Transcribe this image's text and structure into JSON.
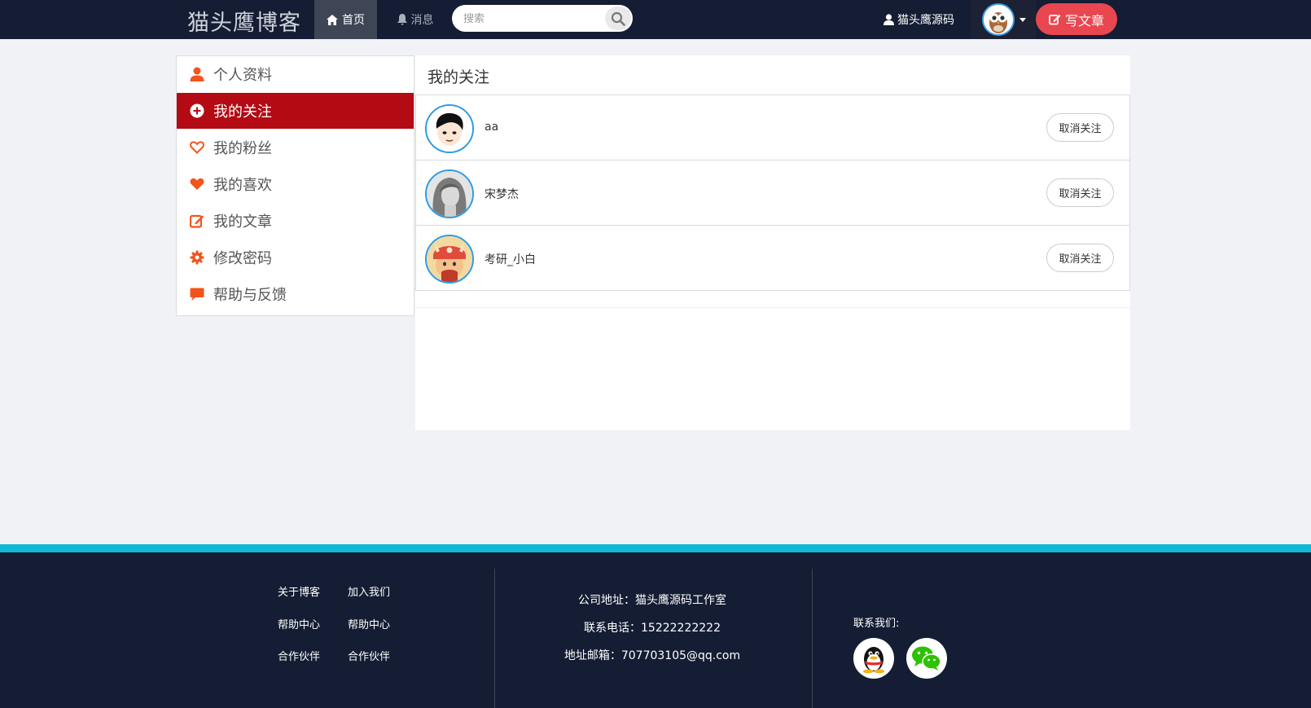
{
  "header": {
    "brand": "猫头鹰博客",
    "nav": [
      {
        "label": "首页",
        "icon": "home-icon",
        "active": true
      },
      {
        "label": "消息",
        "icon": "bell-icon",
        "active": false
      }
    ],
    "search_placeholder": "搜索",
    "username": "猫头鹰源码",
    "write_label": "写文章"
  },
  "sidebar": {
    "items": [
      {
        "label": "个人资料",
        "icon": "user-icon",
        "active": false
      },
      {
        "label": "我的关注",
        "icon": "plus-circle-icon",
        "active": true
      },
      {
        "label": "我的粉丝",
        "icon": "heart-outline-icon",
        "active": false
      },
      {
        "label": "我的喜欢",
        "icon": "heart-icon",
        "active": false
      },
      {
        "label": "我的文章",
        "icon": "edit-icon",
        "active": false
      },
      {
        "label": "修改密码",
        "icon": "gear-icon",
        "active": false
      },
      {
        "label": "帮助与反馈",
        "icon": "comment-icon",
        "active": false
      }
    ]
  },
  "main": {
    "title": "我的关注",
    "follows": [
      {
        "name": "aa",
        "action": "取消关注"
      },
      {
        "name": "宋梦杰",
        "action": "取消关注"
      },
      {
        "name": "考研_小白",
        "action": "取消关注"
      }
    ]
  },
  "footer": {
    "links_col1": [
      "关于博客",
      "帮助中心",
      "合作伙伴"
    ],
    "links_col2": [
      "加入我们",
      "帮助中心",
      "合作伙伴"
    ],
    "address": "公司地址：猫头鹰源码工作室",
    "phone": "联系电话：15222222222",
    "email": "地址邮箱：707703105@qq.com",
    "contact_label": "联系我们:",
    "socials": [
      "qq-icon",
      "wechat-icon"
    ]
  },
  "colors": {
    "nav_bg": "#141d33",
    "accent_red": "#b30a14",
    "write_btn": "#e8474f",
    "icon_orange": "#f2541b",
    "footer_stripe": "#11b8d6",
    "avatar_border": "#2e9be3"
  }
}
